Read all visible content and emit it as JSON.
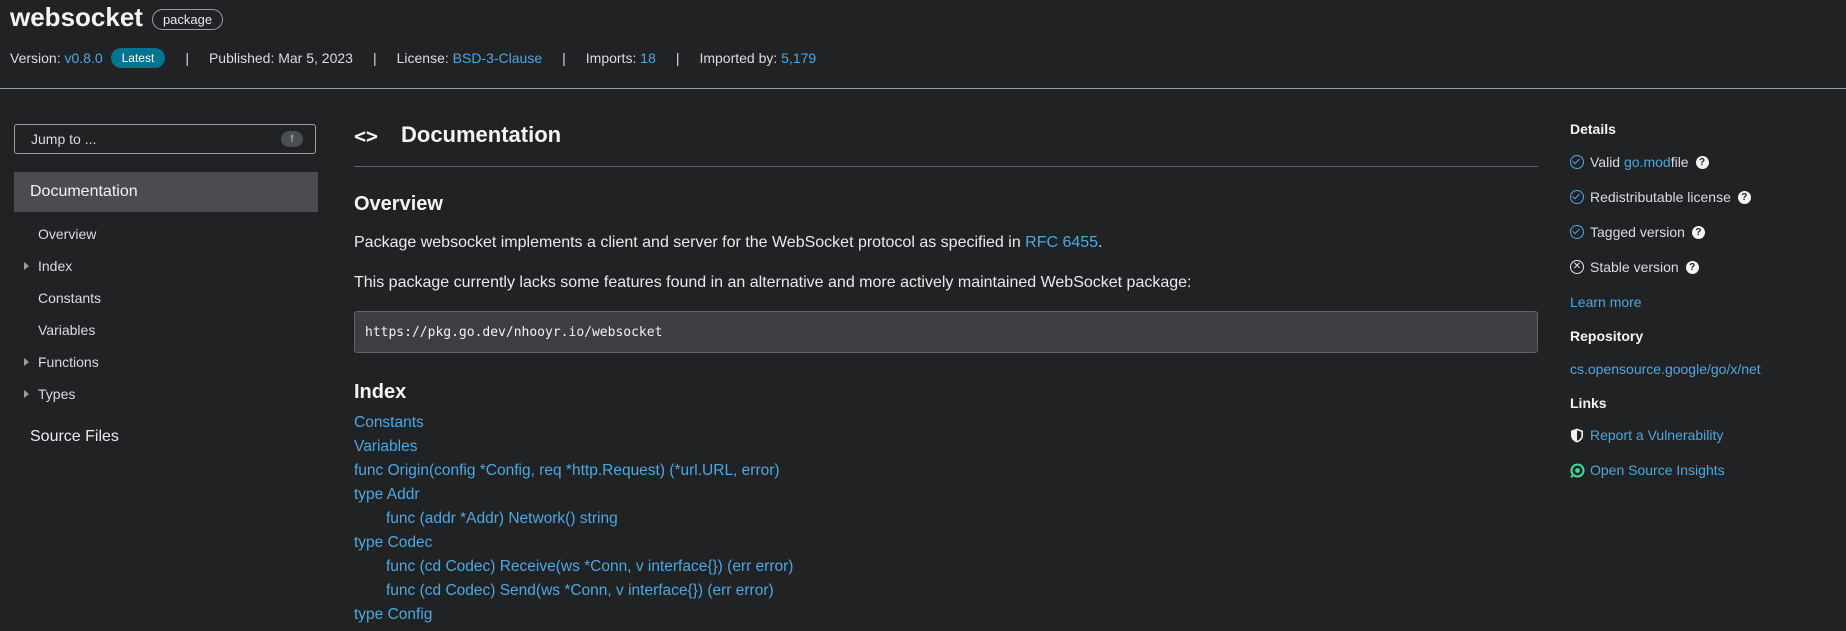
{
  "header": {
    "title": "websocket",
    "badge": "package",
    "version_label": "Version:",
    "version": "v0.8.0",
    "latest_badge": "Latest",
    "published_label": "Published: Mar 5, 2023",
    "license_label": "License:",
    "license": "BSD-3-Clause",
    "imports_label": "Imports:",
    "imports": "18",
    "imported_by_label": "Imported by:",
    "imported_by": "5,179",
    "separator": "|"
  },
  "left_nav": {
    "jump_placeholder": "Jump to ...",
    "jump_shortcut": "f",
    "documentation": "Documentation",
    "items": [
      {
        "label": "Overview",
        "expandable": false
      },
      {
        "label": "Index",
        "expandable": true
      },
      {
        "label": "Constants",
        "expandable": false
      },
      {
        "label": "Variables",
        "expandable": false
      },
      {
        "label": "Functions",
        "expandable": true
      },
      {
        "label": "Types",
        "expandable": true
      }
    ],
    "source_files": "Source Files"
  },
  "main": {
    "code_icon": "<>",
    "doc_title": "Documentation",
    "overview_heading": "Overview",
    "overview_p1_before": "Package websocket implements a client and server for the WebSocket protocol as specified in ",
    "overview_p1_link": "RFC 6455",
    "overview_p1_after": ".",
    "overview_p2": "This package currently lacks some features found in an alternative and more actively maintained WebSocket package:",
    "code_url": "https://pkg.go.dev/nhooyr.io/websocket",
    "index_heading": "Index",
    "index_items": [
      {
        "label": "Constants",
        "indent": false
      },
      {
        "label": "Variables",
        "indent": false
      },
      {
        "label": "func Origin(config *Config, req *http.Request) (*url.URL, error)",
        "indent": false
      },
      {
        "label": "type Addr",
        "indent": false
      },
      {
        "label": "func (addr *Addr) Network() string",
        "indent": true
      },
      {
        "label": "type Codec",
        "indent": false
      },
      {
        "label": "func (cd Codec) Receive(ws *Conn, v interface{}) (err error)",
        "indent": true
      },
      {
        "label": "func (cd Codec) Send(ws *Conn, v interface{}) (err error)",
        "indent": true
      },
      {
        "label": "type Config",
        "indent": false
      }
    ]
  },
  "right": {
    "details_heading": "Details",
    "valid_prefix": "Valid ",
    "valid_link": "go.mod",
    "valid_suffix": " file",
    "redistributable": "Redistributable license",
    "tagged": "Tagged version",
    "stable": "Stable version",
    "learn_more": "Learn more",
    "repository_heading": "Repository",
    "repository_link": "cs.opensource.google/go/x/net",
    "links_heading": "Links",
    "report_vuln": "Report a Vulnerability",
    "osi": "Open Source Insights",
    "help_glyph": "?",
    "x_glyph": "✕"
  },
  "colors": {
    "background": "#202224",
    "link": "#4ea7e0",
    "latest_badge": "#00758f"
  }
}
